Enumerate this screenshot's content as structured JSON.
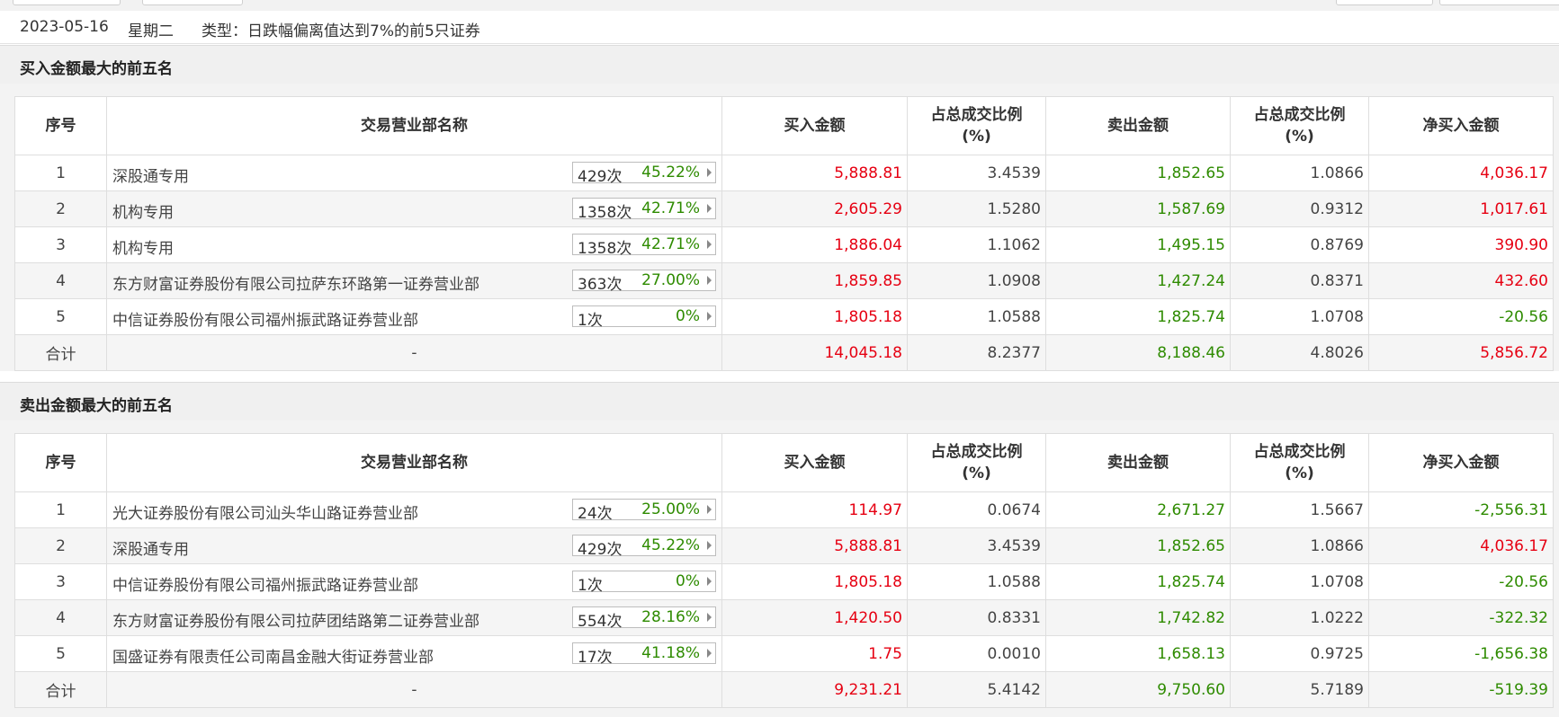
{
  "header": {
    "date": "2023-05-16",
    "weekday": "星期二",
    "type_label": "类型：日跌幅偏离值达到7%的前5只证券"
  },
  "colors": {
    "buy_red": "#e60012",
    "sell_green": "#2e8b00"
  },
  "columns": {
    "seq": "序号",
    "branch": "交易营业部名称",
    "buy": "买入金额",
    "ratio_l1": "占总成交比例",
    "ratio_l2": "(%)",
    "sell": "卖出金额",
    "net": "净买入金额"
  },
  "sections": [
    {
      "title": "买入金额最大的前五名",
      "rows": [
        {
          "seq": "1",
          "name": "深股通专用",
          "count": "429次",
          "pct": "45.22%",
          "buy": "5,888.81",
          "buy_ratio": "3.4539",
          "sell": "1,852.65",
          "sell_ratio": "1.0866",
          "net": "4,036.17",
          "net_sign": "pos"
        },
        {
          "seq": "2",
          "name": "机构专用",
          "count": "1358次",
          "pct": "42.71%",
          "buy": "2,605.29",
          "buy_ratio": "1.5280",
          "sell": "1,587.69",
          "sell_ratio": "0.9312",
          "net": "1,017.61",
          "net_sign": "pos"
        },
        {
          "seq": "3",
          "name": "机构专用",
          "count": "1358次",
          "pct": "42.71%",
          "buy": "1,886.04",
          "buy_ratio": "1.1062",
          "sell": "1,495.15",
          "sell_ratio": "0.8769",
          "net": "390.90",
          "net_sign": "pos"
        },
        {
          "seq": "4",
          "name": "东方财富证券股份有限公司拉萨东环路第一证券营业部",
          "count": "363次",
          "pct": "27.00%",
          "buy": "1,859.85",
          "buy_ratio": "1.0908",
          "sell": "1,427.24",
          "sell_ratio": "0.8371",
          "net": "432.60",
          "net_sign": "pos"
        },
        {
          "seq": "5",
          "name": "中信证券股份有限公司福州振武路证券营业部",
          "count": "1次",
          "pct": "0%",
          "buy": "1,805.18",
          "buy_ratio": "1.0588",
          "sell": "1,825.74",
          "sell_ratio": "1.0708",
          "net": "-20.56",
          "net_sign": "neg"
        }
      ],
      "total": {
        "label": "合计",
        "name": "-",
        "buy": "14,045.18",
        "buy_ratio": "8.2377",
        "sell": "8,188.46",
        "sell_ratio": "4.8026",
        "net": "5,856.72",
        "net_sign": "pos"
      }
    },
    {
      "title": "卖出金额最大的前五名",
      "rows": [
        {
          "seq": "1",
          "name": "光大证券股份有限公司汕头华山路证券营业部",
          "count": "24次",
          "pct": "25.00%",
          "buy": "114.97",
          "buy_ratio": "0.0674",
          "sell": "2,671.27",
          "sell_ratio": "1.5667",
          "net": "-2,556.31",
          "net_sign": "neg"
        },
        {
          "seq": "2",
          "name": "深股通专用",
          "count": "429次",
          "pct": "45.22%",
          "buy": "5,888.81",
          "buy_ratio": "3.4539",
          "sell": "1,852.65",
          "sell_ratio": "1.0866",
          "net": "4,036.17",
          "net_sign": "pos"
        },
        {
          "seq": "3",
          "name": "中信证券股份有限公司福州振武路证券营业部",
          "count": "1次",
          "pct": "0%",
          "buy": "1,805.18",
          "buy_ratio": "1.0588",
          "sell": "1,825.74",
          "sell_ratio": "1.0708",
          "net": "-20.56",
          "net_sign": "neg"
        },
        {
          "seq": "4",
          "name": "东方财富证券股份有限公司拉萨团结路第二证券营业部",
          "count": "554次",
          "pct": "28.16%",
          "buy": "1,420.50",
          "buy_ratio": "0.8331",
          "sell": "1,742.82",
          "sell_ratio": "1.0222",
          "net": "-322.32",
          "net_sign": "neg"
        },
        {
          "seq": "5",
          "name": "国盛证券有限责任公司南昌金融大街证券营业部",
          "count": "17次",
          "pct": "41.18%",
          "buy": "1.75",
          "buy_ratio": "0.0010",
          "sell": "1,658.13",
          "sell_ratio": "0.9725",
          "net": "-1,656.38",
          "net_sign": "neg"
        }
      ],
      "total": {
        "label": "合计",
        "name": "-",
        "buy": "9,231.21",
        "buy_ratio": "5.4142",
        "sell": "9,750.60",
        "sell_ratio": "5.7189",
        "net": "-519.39",
        "net_sign": "neg"
      }
    }
  ]
}
